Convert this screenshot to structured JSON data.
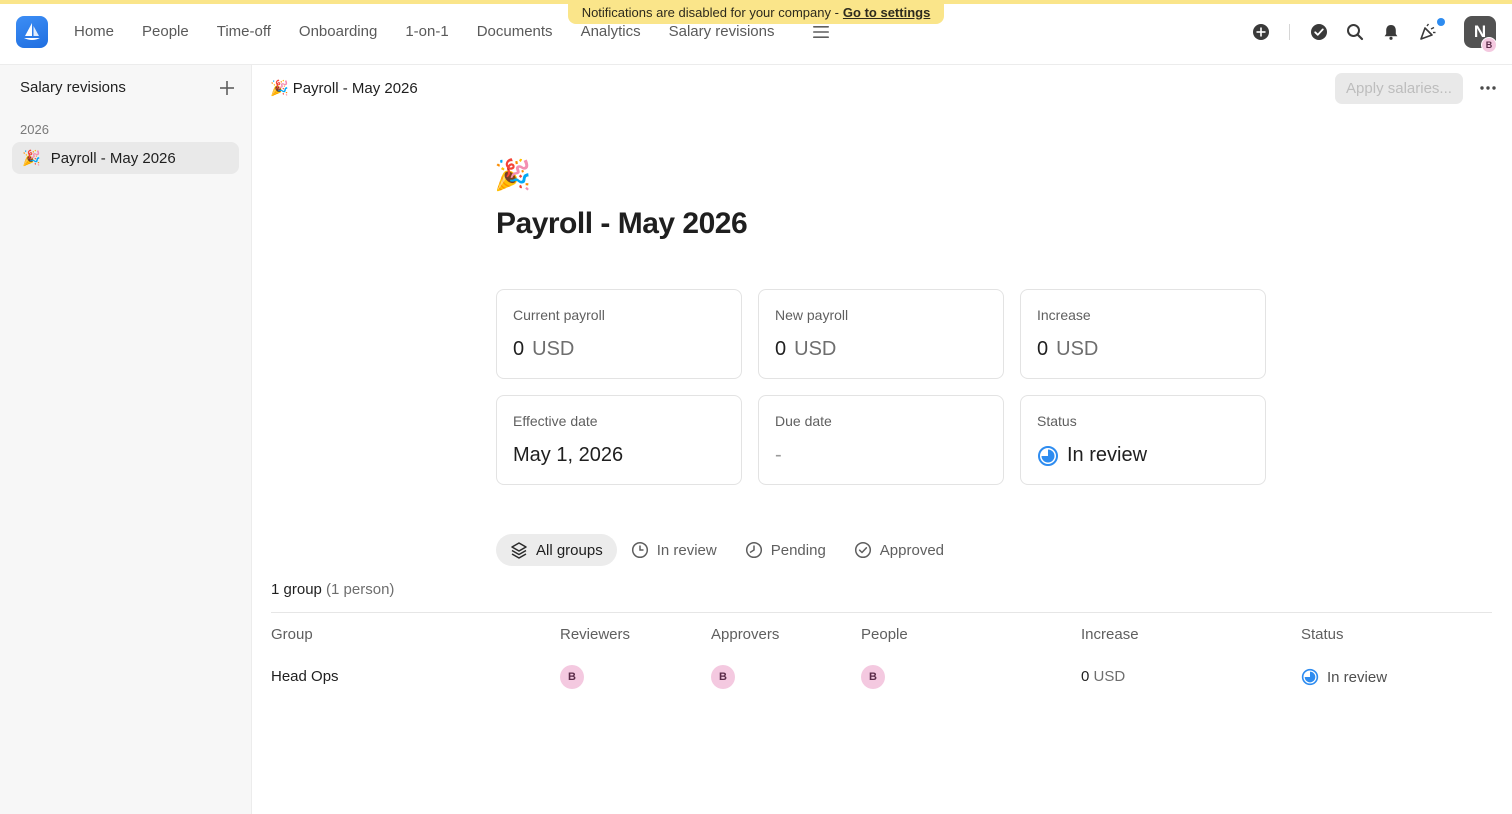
{
  "banner": {
    "text": "Notifications are disabled for your company -",
    "link": "Go to settings"
  },
  "nav": {
    "items": [
      "Home",
      "People",
      "Time-off",
      "Onboarding",
      "1-on-1",
      "Documents",
      "Analytics",
      "Salary revisions"
    ],
    "avatar_initial": "N",
    "avatar_badge": "B"
  },
  "sidebar": {
    "title": "Salary revisions",
    "year": "2026",
    "item_emoji": "🎉",
    "item_label": "Payroll - May 2026"
  },
  "header": {
    "breadcrumb_emoji": "🎉",
    "breadcrumb": "Payroll - May 2026",
    "apply_button": "Apply salaries..."
  },
  "page": {
    "emoji": "🎉",
    "title": "Payroll - May 2026"
  },
  "cards": {
    "current_payroll": {
      "label": "Current payroll",
      "value": "0",
      "unit": "USD"
    },
    "new_payroll": {
      "label": "New payroll",
      "value": "0",
      "unit": "USD"
    },
    "increase": {
      "label": "Increase",
      "value": "0",
      "unit": "USD"
    },
    "effective_date": {
      "label": "Effective date",
      "value": "May 1, 2026"
    },
    "due_date": {
      "label": "Due date",
      "value": "-"
    },
    "status": {
      "label": "Status",
      "value": "In review"
    }
  },
  "filters": {
    "all": "All groups",
    "in_review": "In review",
    "pending": "Pending",
    "approved": "Approved"
  },
  "summary": {
    "count": "1 group",
    "detail": "(1 person)"
  },
  "table": {
    "headers": {
      "group": "Group",
      "reviewers": "Reviewers",
      "approvers": "Approvers",
      "people": "People",
      "increase": "Increase",
      "status": "Status"
    },
    "rows": [
      {
        "group": "Head Ops",
        "reviewer": "B",
        "approver": "B",
        "person": "B",
        "increase_value": "0",
        "increase_unit": "USD",
        "status": "In review"
      }
    ]
  },
  "colors": {
    "accent": "#2e8cf0",
    "banner": "#fae58a",
    "avatar_bubble": "#f4c9e0"
  }
}
